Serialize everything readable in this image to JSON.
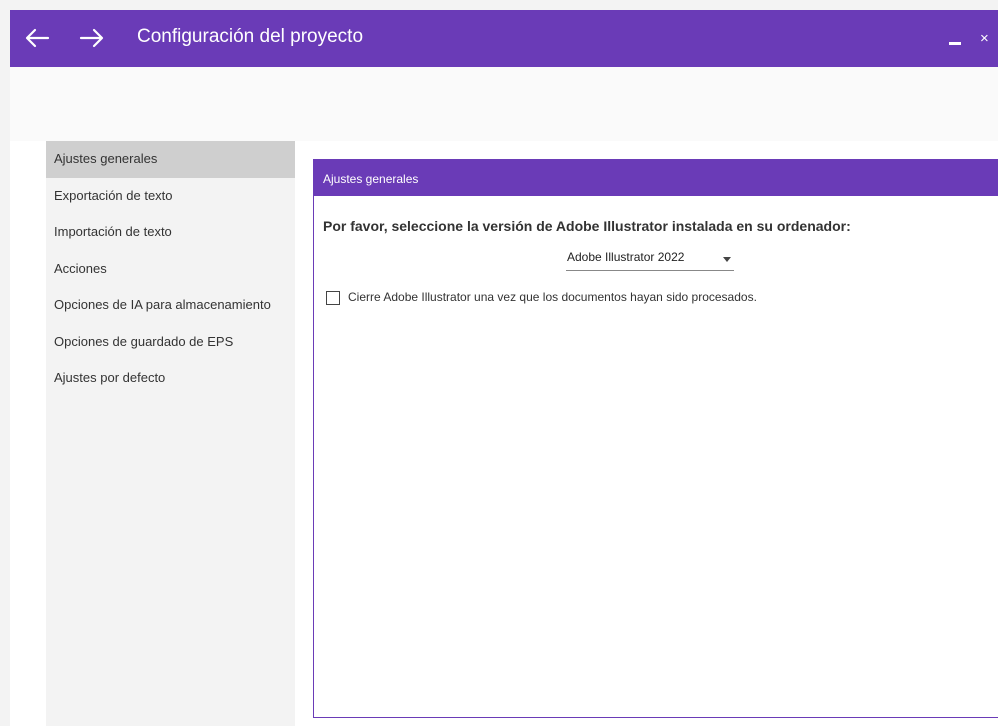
{
  "window": {
    "title": "Configuración del proyecto",
    "close_glyph": "×"
  },
  "icons": {
    "back": "arrow-left-icon",
    "forward": "arrow-right-icon",
    "minimize": "minimize-icon",
    "close": "close-icon",
    "dropdown": "chevron-down-icon"
  },
  "colors": {
    "accent": "#6a3bb7",
    "selected_item": "#cfcfcf",
    "sidebar_bg": "#f3f3f3"
  },
  "sidebar": {
    "items": [
      {
        "label": "Ajustes generales",
        "active": true
      },
      {
        "label": "Exportación de texto"
      },
      {
        "label": "Importación de texto"
      },
      {
        "label": "Acciones"
      },
      {
        "label": "Opciones de IA para almacenamiento"
      },
      {
        "label": "Opciones de guardado de EPS"
      },
      {
        "label": "Ajustes por defecto"
      }
    ]
  },
  "panel": {
    "header": "Ajustes generales",
    "prompt": "Por favor, seleccione la versión de Adobe Illustrator instalada en su ordenador:",
    "version_select": {
      "value": "Adobe Illustrator 2022"
    },
    "close_checkbox": {
      "label": "Cierre Adobe Illustrator una vez que los documentos hayan sido procesados.",
      "checked": false
    }
  }
}
